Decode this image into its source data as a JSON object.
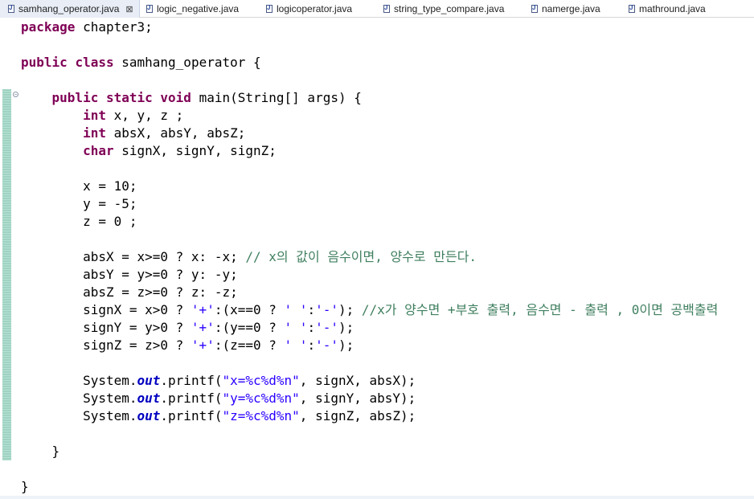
{
  "tabs": [
    {
      "name": "samhang_operator.java",
      "active": true,
      "close_icon": "⊠"
    },
    {
      "name": "logic_negative.java"
    },
    {
      "name": "logicoperator.java"
    },
    {
      "name": "string_type_compare.java"
    },
    {
      "name": "namerge.java"
    },
    {
      "name": "mathround.java"
    }
  ],
  "colors": {
    "keyword": "#7f0055",
    "string": "#2a00ff",
    "comment": "#3f7f5f",
    "static_field": "#0000c0",
    "ruler": "#a6d8c8"
  },
  "editor": {
    "lines": [
      [
        [
          "kw",
          "package"
        ],
        [
          "t",
          " chapter3;"
        ]
      ],
      [],
      [
        [
          "kw",
          "public"
        ],
        [
          "t",
          " "
        ],
        [
          "kw",
          "class"
        ],
        [
          "t",
          " samhang_operator {"
        ]
      ],
      [],
      [
        [
          "t",
          "    "
        ],
        [
          "kw",
          "public"
        ],
        [
          "t",
          " "
        ],
        [
          "kw",
          "static"
        ],
        [
          "t",
          " "
        ],
        [
          "kw",
          "void"
        ],
        [
          "t",
          " main(String[] args) {"
        ]
      ],
      [
        [
          "t",
          "        "
        ],
        [
          "kw",
          "int"
        ],
        [
          "t",
          " x, y, z ;"
        ]
      ],
      [
        [
          "t",
          "        "
        ],
        [
          "kw",
          "int"
        ],
        [
          "t",
          " absX, absY, absZ;"
        ]
      ],
      [
        [
          "t",
          "        "
        ],
        [
          "kw",
          "char"
        ],
        [
          "t",
          " signX, signY, signZ;"
        ]
      ],
      [],
      [
        [
          "t",
          "        x = 10;"
        ]
      ],
      [
        [
          "t",
          "        y = -5;"
        ]
      ],
      [
        [
          "t",
          "        z = 0 ;"
        ]
      ],
      [],
      [
        [
          "t",
          "        absX = x>=0 ? x: -x; "
        ],
        [
          "cm",
          "// x의 값이 음수이면, 양수로 만든다."
        ]
      ],
      [
        [
          "t",
          "        absY = y>=0 ? y: -y;"
        ]
      ],
      [
        [
          "t",
          "        absZ = z>=0 ? z: -z;"
        ]
      ],
      [
        [
          "t",
          "        signX = x>0 ? "
        ],
        [
          "str",
          "'+'"
        ],
        [
          "t",
          ":(x==0 ? "
        ],
        [
          "str",
          "' '"
        ],
        [
          "t",
          ":"
        ],
        [
          "str",
          "'-'"
        ],
        [
          "t",
          "); "
        ],
        [
          "cm",
          "//x가 양수면 +부호 출력, 음수면 - 출력 , 0이면 공백출력"
        ]
      ],
      [
        [
          "t",
          "        signY = y>0 ? "
        ],
        [
          "str",
          "'+'"
        ],
        [
          "t",
          ":(y==0 ? "
        ],
        [
          "str",
          "' '"
        ],
        [
          "t",
          ":"
        ],
        [
          "str",
          "'-'"
        ],
        [
          "t",
          ");"
        ]
      ],
      [
        [
          "t",
          "        signZ = z>0 ? "
        ],
        [
          "str",
          "'+'"
        ],
        [
          "t",
          ":(z==0 ? "
        ],
        [
          "str",
          "' '"
        ],
        [
          "t",
          ":"
        ],
        [
          "str",
          "'-'"
        ],
        [
          "t",
          ");"
        ]
      ],
      [],
      [
        [
          "t",
          "        System."
        ],
        [
          "fld",
          "out"
        ],
        [
          "t",
          ".printf("
        ],
        [
          "str",
          "\"x=%c%d%n\""
        ],
        [
          "t",
          ", signX, absX);"
        ]
      ],
      [
        [
          "t",
          "        System."
        ],
        [
          "fld",
          "out"
        ],
        [
          "t",
          ".printf("
        ],
        [
          "str",
          "\"y=%c%d%n\""
        ],
        [
          "t",
          ", signY, absY);"
        ]
      ],
      [
        [
          "t",
          "        System."
        ],
        [
          "fld",
          "out"
        ],
        [
          "t",
          ".printf("
        ],
        [
          "str",
          "\"z=%c%d%n\""
        ],
        [
          "t",
          ", signZ, absZ);"
        ]
      ],
      [],
      [
        [
          "t",
          "    }"
        ]
      ],
      [],
      [
        [
          "t",
          "}"
        ]
      ]
    ]
  }
}
